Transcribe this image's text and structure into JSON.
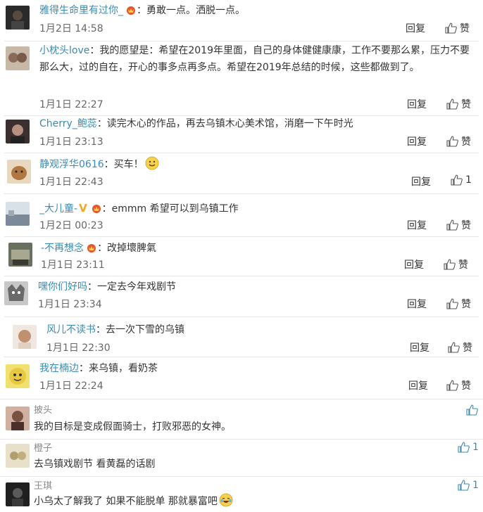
{
  "comments": [
    {
      "name": "雅得生命里有过你_",
      "text": "：勇敢一点。洒脱一点。",
      "time": "1月2日 14:58",
      "reply": "回复",
      "like": "赞",
      "avatar_color": "#3a3a3a"
    },
    {
      "name": "小枕头love",
      "text": "：我的愿望是：希望在2019年里面，自己的身体健健康康，工作不要那么累，压力不要那么大，过的自在，开心的事多点再多点。希望在2019年总结的时候，这些都做到了。",
      "time": "1月1日 22:27",
      "reply": "回复",
      "like": "赞",
      "avatar_color": "#8a7a6a"
    },
    {
      "name": "Cherry_鲍蕊",
      "text": "：读完木心的作品，再去乌镇木心美术馆，消磨一下午时光",
      "time": "1月1日 23:13",
      "reply": "回复",
      "like": "赞",
      "avatar_color": "#6a5040"
    },
    {
      "name": "静观浮华0616",
      "text": "：买车！",
      "time": "1月1日 22:43",
      "reply": "回复",
      "like": "1",
      "avatar_color": "#b08050"
    },
    {
      "name": "_大儿童-",
      "text": "：emmm 希望可以到乌镇工作",
      "time": "1月2日 00:23",
      "reply": "回复",
      "like": "赞",
      "avatar_color": "#7a8a98"
    },
    {
      "name": "-不再想念",
      "text": "：改掉壞脾氣",
      "time": "1月1日 23:11",
      "reply": "回复",
      "like": "赞",
      "avatar_color": "#5a6050"
    },
    {
      "name": "嘿你们好吗",
      "text": "：一定去今年戏剧节",
      "time": "1月1日 23:34",
      "reply": "回复",
      "like": "赞",
      "avatar_color": "#707070"
    },
    {
      "name": "风儿不读书",
      "text": "：去一次下雪的乌镇",
      "time": "1月1日 22:30",
      "reply": "回复",
      "like": "赞",
      "avatar_color": "#c09070"
    },
    {
      "name": "我在楠边",
      "text": "：来乌镇，看奶茶",
      "time": "1月1日 22:24",
      "reply": "回复",
      "like": "赞",
      "avatar_color": "#d8c040"
    }
  ],
  "simple_comments": [
    {
      "name": "披头",
      "text": "我的目标是变成假面骑士，打败邪恶的女神。",
      "like": "",
      "avatar_color": "#7a5040"
    },
    {
      "name": "橙子",
      "text": "去乌镇戏剧节 看黄磊的话剧",
      "like": "1",
      "avatar_color": "#b0a070"
    },
    {
      "name": "王琪",
      "text": "小乌太了解我了 如果不能脱单 那就暴富吧",
      "like": "1",
      "avatar_color": "#303030"
    }
  ],
  "icons": {
    "badge": "crown-badge-icon",
    "like": "thumb-up-icon",
    "smiley": "smiley-icon",
    "vip": "v-vip-icon"
  },
  "colors": {
    "name": "#3a8bb3",
    "badge": "#e8542b",
    "smiley": "#f6d14b"
  }
}
